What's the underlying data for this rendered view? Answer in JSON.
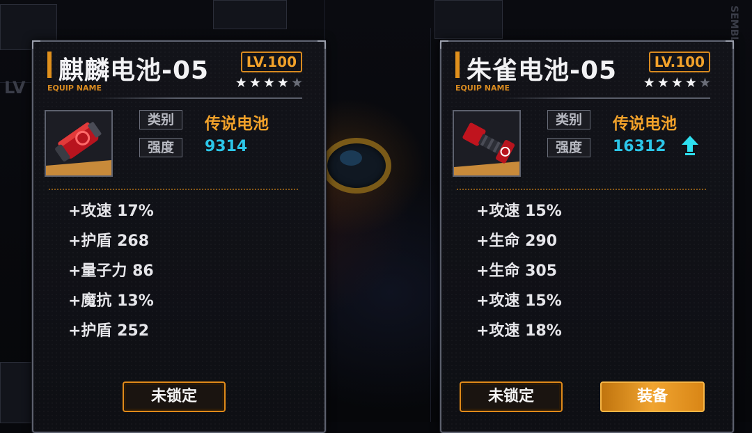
{
  "left_card": {
    "name": "麒麟电池-05",
    "sub_label": "EQUIP NAME",
    "level": "LV.100",
    "stars_filled": 4,
    "stars_total": 5,
    "type_label": "类别",
    "type_value": "传说电池",
    "power_label": "强度",
    "power_value": "9314",
    "stats": [
      "+攻速 17%",
      "+护盾 268",
      "+量子力 86",
      "+魔抗 13%",
      "+护盾 252"
    ],
    "lock_button": "未锁定"
  },
  "right_card": {
    "name": "朱雀电池-05",
    "sub_label": "EQUIP NAME",
    "level": "LV.100",
    "stars_filled": 4,
    "stars_total": 5,
    "type_label": "类别",
    "type_value": "传说电池",
    "power_label": "强度",
    "power_value": "16312",
    "power_trend": "up-arrow-icon",
    "stats": [
      "+攻速 15%",
      "+生命 290",
      "+生命 305",
      "+攻速 15%",
      "+攻速 18%"
    ],
    "lock_button": "未锁定",
    "equip_button": "装备"
  },
  "background": {
    "partial_text": "LV",
    "side_text": "SEMBL"
  },
  "colors": {
    "accent_orange": "#f2a22a",
    "power_cyan": "#2cc6e8",
    "panel_border": "#5d616e"
  }
}
